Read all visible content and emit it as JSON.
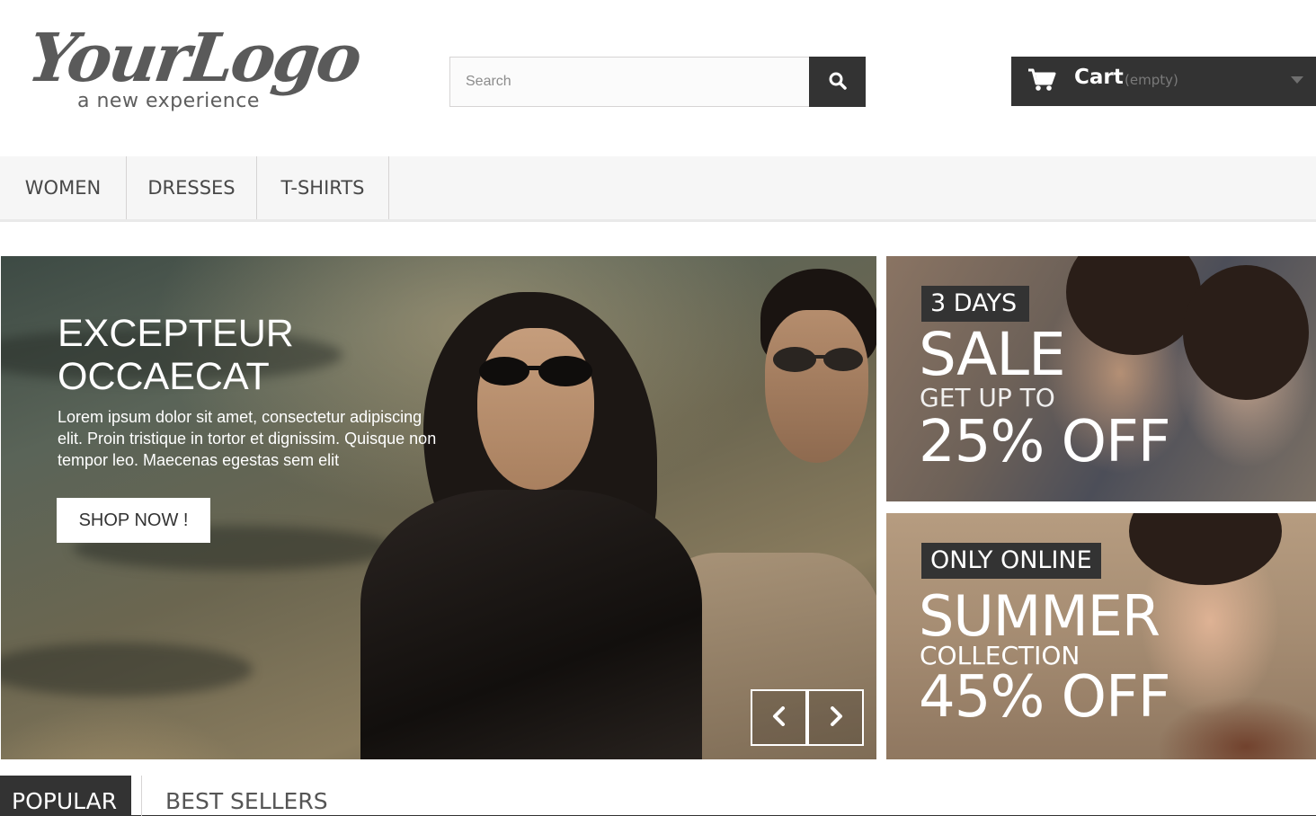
{
  "logo": {
    "script_text": "YourLogo",
    "tagline": "a new experience"
  },
  "search": {
    "placeholder": "Search",
    "value": "",
    "icon": "search-icon"
  },
  "cart": {
    "label": "Cart",
    "status": "(empty)",
    "icon": "shopping-cart-icon"
  },
  "nav": {
    "items": [
      {
        "label": "WOMEN"
      },
      {
        "label": "DRESSES"
      },
      {
        "label": "T-SHIRTS"
      }
    ]
  },
  "hero": {
    "title": "EXCEPTEUR OCCAECAT",
    "text": "Lorem ipsum dolor sit amet, consectetur adipiscing elit. Proin tristique in tortor et dignissim. Quisque non tempor leo. Maecenas egestas sem elit",
    "button_label": "SHOP NOW !",
    "prev_icon": "chevron-left-icon",
    "next_icon": "chevron-right-icon"
  },
  "promos": [
    {
      "badge": "3 DAYS",
      "line1": "SALE",
      "line2": "GET UP TO",
      "line3": "25% OFF"
    },
    {
      "badge": "ONLY ONLINE",
      "line1": "SUMMER",
      "line2": "COLLECTION",
      "line3": "45% OFF"
    }
  ],
  "tabs": [
    {
      "label": "POPULAR",
      "active": true
    },
    {
      "label": "BEST SELLERS",
      "active": false
    }
  ],
  "colors": {
    "dark": "#333333",
    "nav_bg": "#f6f6f6",
    "white": "#ffffff"
  }
}
